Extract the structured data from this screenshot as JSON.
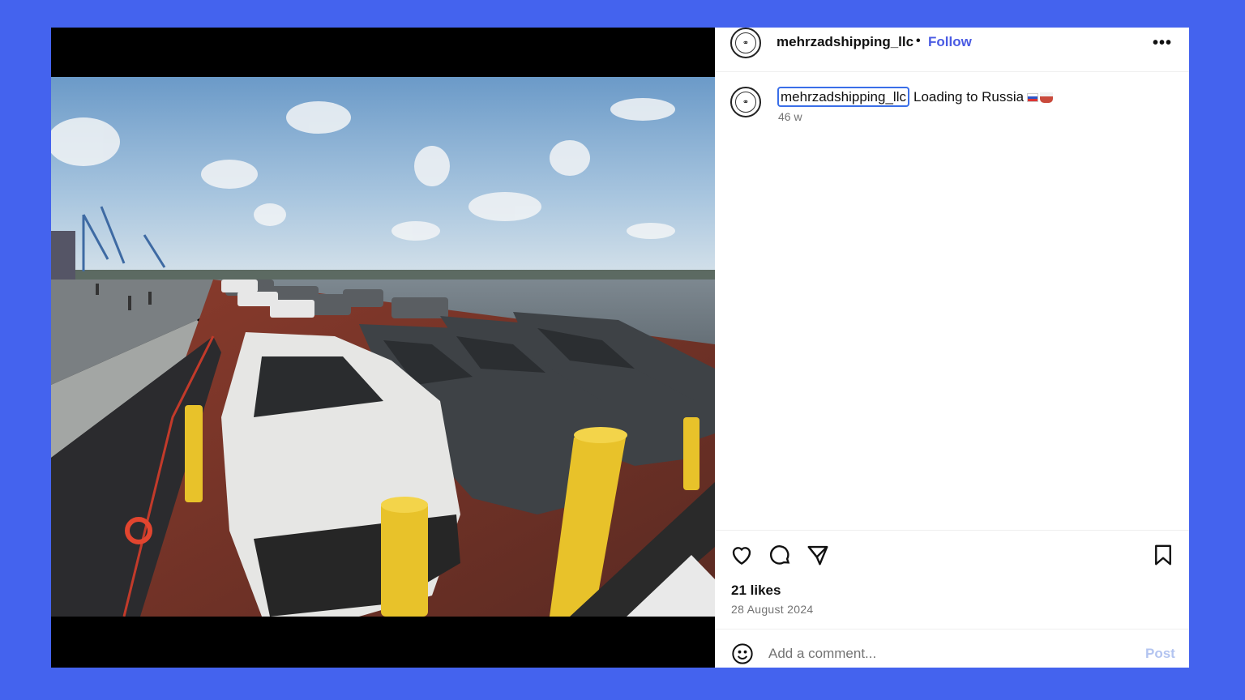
{
  "post": {
    "username": "mehrzadshipping_llc",
    "separator": "•",
    "follow_label": "Follow",
    "more_label": "•••",
    "caption_user": "mehrzadshipping_llc",
    "caption_text": "Loading to Russia",
    "time_ago": "46 w",
    "likes": "21 likes",
    "date": "28 August 2024"
  },
  "comment": {
    "placeholder": "Add a comment...",
    "post_label": "Post"
  },
  "icons": {
    "like": "heart-icon",
    "comment": "speech-bubble-icon",
    "share": "paper-plane-icon",
    "save": "bookmark-icon",
    "emoji": "smiley-icon"
  },
  "colors": {
    "background": "#4463ee",
    "accent": "#4a5be3",
    "post_disabled": "#b3c4f0"
  }
}
